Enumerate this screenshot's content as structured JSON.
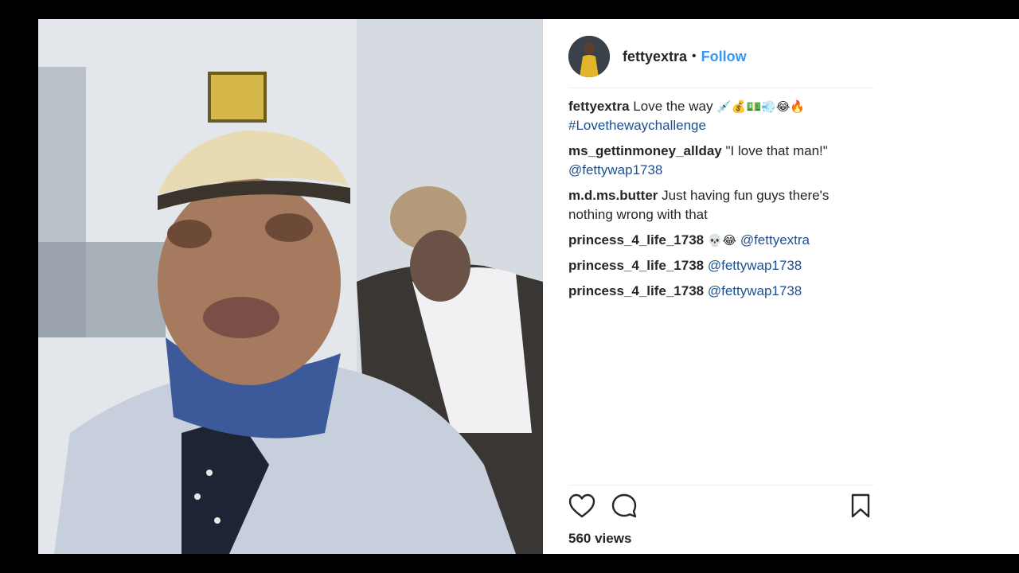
{
  "post": {
    "username": "fettyextra",
    "separator": "•",
    "follow_label": "Follow",
    "views_label": "560 views"
  },
  "comments": [
    {
      "user": "fettyextra",
      "text": "Love the way",
      "emoji": "💉💰💵💨😂🔥",
      "tag": "#Lovethewaychallenge"
    },
    {
      "user": "ms_gettinmoney_allday",
      "text": "\"I love that man!\"",
      "tag": "@fettywap1738"
    },
    {
      "user": "m.d.ms.butter",
      "text": "Just having fun guys there's nothing wrong with that"
    },
    {
      "user": "princess_4_life_1738",
      "emoji": "💀😂",
      "tag": "@fettyextra"
    },
    {
      "user": "princess_4_life_1738",
      "tag": "@fettywap1738"
    },
    {
      "user": "princess_4_life_1738",
      "tag": "@fettywap1738"
    }
  ],
  "icons": {
    "like": "heart-icon",
    "comment": "comment-icon",
    "save": "bookmark-icon"
  },
  "colors": {
    "link": "#3897f0",
    "hashtag": "#1f4f8f",
    "text": "#262626"
  }
}
